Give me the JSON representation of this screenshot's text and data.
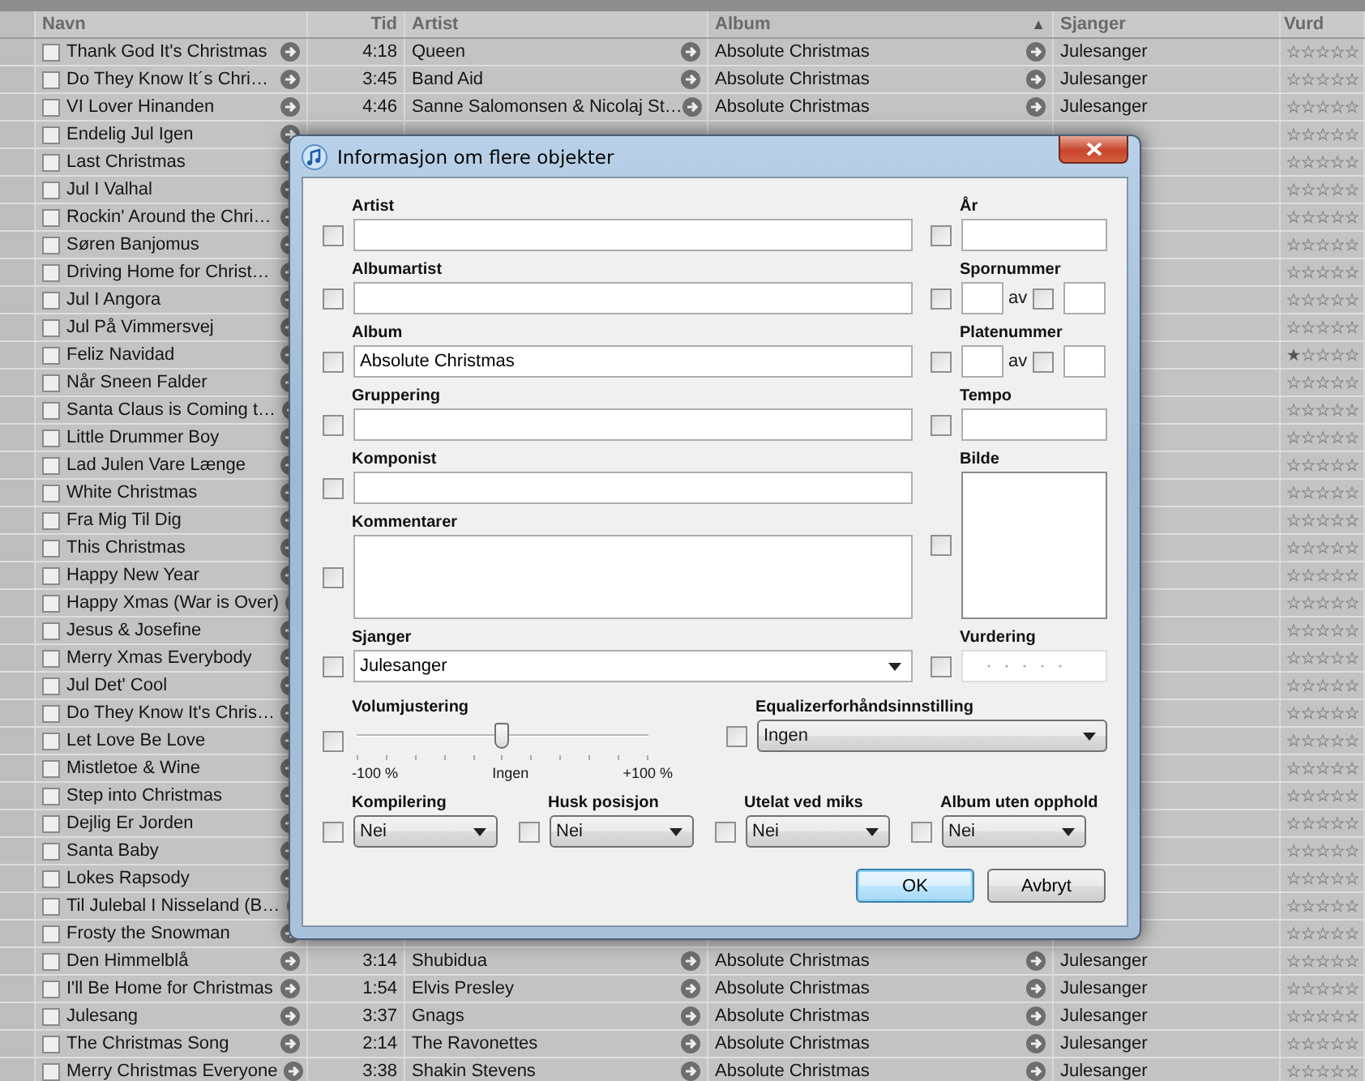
{
  "table": {
    "columns": [
      {
        "label": "Navn"
      },
      {
        "label": "Tid"
      },
      {
        "label": "Artist"
      },
      {
        "label": "Album",
        "sort_indicator": "▲"
      },
      {
        "label": "Sjanger"
      },
      {
        "label": "Vurd"
      }
    ],
    "rows": [
      {
        "name": "Thank God It's Christmas",
        "time": "4:18",
        "artist": "Queen",
        "album": "Absolute Christmas",
        "genre": "Julesanger",
        "checked": false,
        "stars": 0
      },
      {
        "name": "Do They Know It´s Chri…",
        "time": "3:45",
        "artist": "Band Aid",
        "album": "Absolute Christmas",
        "genre": "Julesanger",
        "checked": false,
        "stars": 0
      },
      {
        "name": "VI Lover Hinanden",
        "time": "4:46",
        "artist": "Sanne Salomonsen & Nicolaj St…",
        "album": "Absolute Christmas",
        "genre": "Julesanger",
        "checked": false,
        "stars": 0
      },
      {
        "name": "Endelig Jul Igen",
        "checked": false,
        "stars": 0
      },
      {
        "name": "Last Christmas",
        "checked": false,
        "stars": 0
      },
      {
        "name": "Jul I Valhal",
        "checked": false,
        "stars": 0
      },
      {
        "name": "Rockin' Around the Chri…",
        "checked": false,
        "stars": 0
      },
      {
        "name": "Søren Banjomus",
        "checked": false,
        "stars": 0
      },
      {
        "name": "Driving Home for Christ…",
        "checked": false,
        "stars": 0
      },
      {
        "name": "Jul I Angora",
        "checked": false,
        "stars": 0
      },
      {
        "name": "Jul På Vimmersvej",
        "checked": false,
        "stars": 0
      },
      {
        "name": "Feliz Navidad",
        "checked": false,
        "stars": 1
      },
      {
        "name": "Når Sneen Falder",
        "checked": false,
        "stars": 0
      },
      {
        "name": "Santa Claus is Coming t…",
        "checked": false,
        "stars": 0
      },
      {
        "name": "Little Drummer Boy",
        "checked": false,
        "stars": 0
      },
      {
        "name": "Lad Julen Vare Længe",
        "checked": false,
        "stars": 0
      },
      {
        "name": "White Christmas",
        "checked": false,
        "stars": 0
      },
      {
        "name": "Fra Mig Til Dig",
        "checked": false,
        "stars": 0
      },
      {
        "name": "This Christmas",
        "checked": false,
        "stars": 0
      },
      {
        "name": "Happy New Year",
        "checked": false,
        "stars": 0
      },
      {
        "name": "Happy Xmas (War is Over)",
        "checked": false,
        "stars": 0
      },
      {
        "name": "Jesus & Josefine",
        "checked": false,
        "stars": 0
      },
      {
        "name": "Merry Xmas Everybody",
        "checked": false,
        "stars": 0
      },
      {
        "name": "Jul Det' Cool",
        "checked": false,
        "stars": 0
      },
      {
        "name": "Do They Know It's Chris…",
        "checked": false,
        "stars": 0
      },
      {
        "name": "Let Love Be Love",
        "checked": false,
        "stars": 0
      },
      {
        "name": "Mistletoe & Wine",
        "checked": false,
        "stars": 0
      },
      {
        "name": "Step into Christmas",
        "checked": false,
        "stars": 0
      },
      {
        "name": "Dejlig Er Jorden",
        "checked": false,
        "stars": 0
      },
      {
        "name": "Santa Baby",
        "checked": false,
        "stars": 0
      },
      {
        "name": "Lokes Rapsody",
        "checked": false,
        "stars": 0
      },
      {
        "name": "Til Julebal I Nisseland (B…",
        "checked": false,
        "stars": 0
      },
      {
        "name": "Frosty the Snowman",
        "checked": false,
        "stars": 0
      },
      {
        "name": "Den Himmelblå",
        "time": "3:14",
        "artist": "Shubidua",
        "album": "Absolute Christmas",
        "genre": "Julesanger",
        "checked": false,
        "stars": 0
      },
      {
        "name": "I'll Be Home for Christmas",
        "time": "1:54",
        "artist": "Elvis Presley",
        "album": "Absolute Christmas",
        "genre": "Julesanger",
        "checked": false,
        "stars": 0
      },
      {
        "name": "Julesang",
        "time": "3:37",
        "artist": "Gnags",
        "album": "Absolute Christmas",
        "genre": "Julesanger",
        "checked": false,
        "stars": 0
      },
      {
        "name": "The Christmas Song",
        "time": "2:14",
        "artist": "The Ravonettes",
        "album": "Absolute Christmas",
        "genre": "Julesanger",
        "checked": false,
        "stars": 0
      },
      {
        "name": "Merry Christmas Everyone",
        "time": "3:38",
        "artist": "Shakin Stevens",
        "album": "Absolute Christmas",
        "genre": "Julesanger",
        "checked": false,
        "stars": 0
      }
    ]
  },
  "dialog": {
    "title": "Informasjon om flere objekter",
    "left_fields": [
      {
        "kind": "text",
        "label": "Artist",
        "checked": false
      },
      {
        "kind": "text",
        "label": "Albumartist",
        "checked": false
      },
      {
        "kind": "text",
        "label": "Album",
        "value": "Absolute Christmas",
        "checked": false
      },
      {
        "kind": "text",
        "label": "Gruppering",
        "checked": false
      },
      {
        "kind": "text",
        "label": "Komponist",
        "checked": false
      },
      {
        "kind": "textarea",
        "label": "Kommentarer",
        "checked": false
      },
      {
        "kind": "combo",
        "label": "Sjanger",
        "value": "Julesanger",
        "checked": false
      }
    ],
    "right_fields": [
      {
        "kind": "text",
        "label": "År",
        "checked": false
      },
      {
        "kind": "pair",
        "label": "Spornummer",
        "separator": "av",
        "checked": false,
        "second_checked": false
      },
      {
        "kind": "pair",
        "label": "Platenummer",
        "separator": "av",
        "checked": false,
        "second_checked": false
      },
      {
        "kind": "text",
        "label": "Tempo",
        "checked": false
      },
      {
        "kind": "image",
        "label": "Bilde",
        "checked": false
      },
      {
        "kind": "rating",
        "label": "Vurdering",
        "checked": false,
        "stars": 0
      }
    ],
    "volume": {
      "label": "Volumjustering",
      "checked": false,
      "level": 0.5,
      "min_label": "-100 %",
      "mid_label": "Ingen",
      "max_label": "+100 %"
    },
    "equalizer": {
      "label": "Equalizerforhåndsinnstilling",
      "checked": false,
      "value": "Ingen"
    },
    "options": [
      {
        "label": "Kompilering",
        "value": "Nei",
        "checked": false
      },
      {
        "label": "Husk posisjon",
        "value": "Nei",
        "checked": false
      },
      {
        "label": "Utelat ved miks",
        "value": "Nei",
        "checked": false
      },
      {
        "label": "Album uten opphold",
        "value": "Nei",
        "checked": false
      }
    ],
    "buttons": [
      {
        "label": "OK",
        "default": true
      },
      {
        "label": "Avbryt",
        "default": false
      }
    ]
  }
}
